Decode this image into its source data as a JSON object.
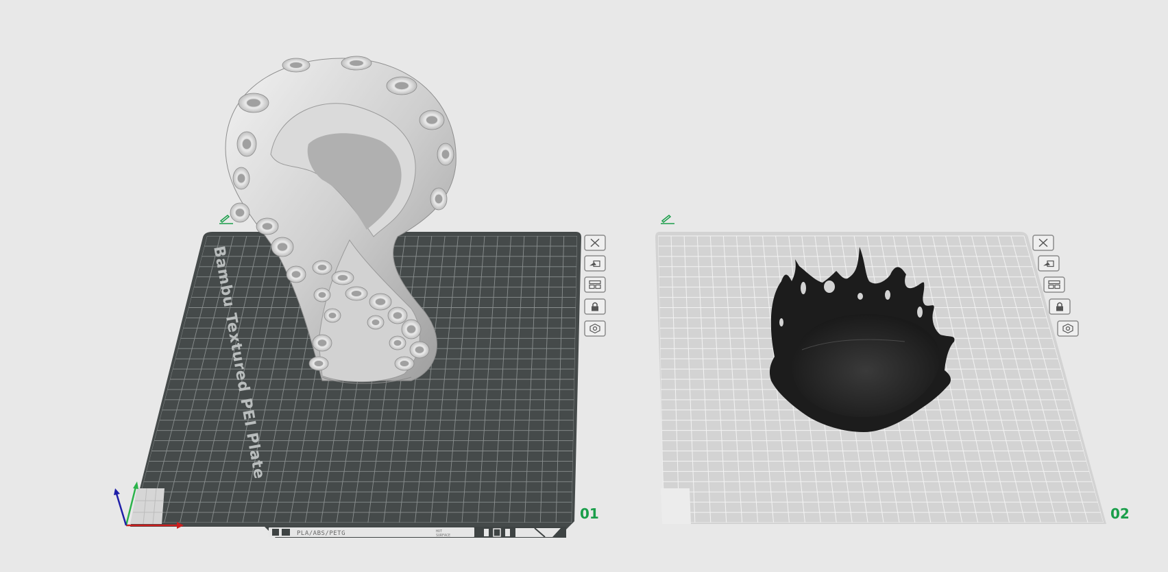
{
  "plates": [
    {
      "number": "01",
      "bed_label": "Bambu Textured PEI Plate",
      "filaments": "PLA/ABS/PETG",
      "footer_small_1": "HOT",
      "footer_small_2": "SURFACE",
      "bed_color": "#454a4a",
      "active": true
    },
    {
      "number": "02",
      "active": false,
      "bed_color": "#d3d3d3"
    }
  ],
  "plate_toolbar": [
    {
      "icon": "close-icon"
    },
    {
      "icon": "auto-orient-icon"
    },
    {
      "icon": "arrange-icon"
    },
    {
      "icon": "lock-icon"
    },
    {
      "icon": "settings-icon"
    }
  ],
  "colors": {
    "accent": "#1a9e4a",
    "axis_x": "#cc1f1f",
    "axis_y": "#2bb34a",
    "axis_z": "#1f1fa8"
  }
}
